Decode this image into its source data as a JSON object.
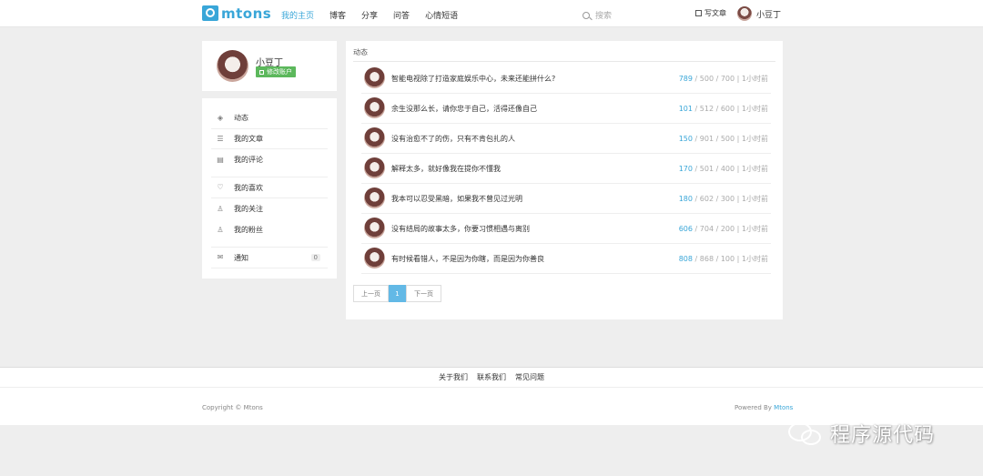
{
  "header": {
    "logo_text": "mtons",
    "nav": [
      "我的主页",
      "博客",
      "分享",
      "问答",
      "心情短语"
    ],
    "search_placeholder": "搜索",
    "write_label": "写文章",
    "username": "小豆丁"
  },
  "profile": {
    "name": "小豆丁",
    "edit_label": "修改账户"
  },
  "menu": {
    "items": [
      {
        "label": "动态",
        "icon": "layers-icon",
        "glyph": "◈"
      },
      {
        "label": "我的文章",
        "icon": "list-icon",
        "glyph": "☰"
      },
      {
        "label": "我的评论",
        "icon": "comment-icon",
        "glyph": "▤"
      },
      {
        "label": "我的喜欢",
        "icon": "heart-icon",
        "glyph": "♡"
      },
      {
        "label": "我的关注",
        "icon": "user-icon",
        "glyph": "♙"
      },
      {
        "label": "我的粉丝",
        "icon": "user-icon",
        "glyph": "♙"
      },
      {
        "label": "通知",
        "icon": "mail-icon",
        "glyph": "✉"
      }
    ],
    "notify_count": "0"
  },
  "feed": {
    "title": "动态",
    "rows": [
      {
        "text": "智能电视除了打造家庭娱乐中心，未来还能拼什么?",
        "a": "789",
        "b": "500",
        "c": "700",
        "time": "1小时前"
      },
      {
        "text": "余生没那么长，请你忠于自己，活得还像自己",
        "a": "101",
        "b": "512",
        "c": "600",
        "time": "1小时前"
      },
      {
        "text": "没有治愈不了的伤，只有不肯包扎的人",
        "a": "150",
        "b": "901",
        "c": "500",
        "time": "1小时前"
      },
      {
        "text": "解释太多，就好像我在提你不懂我",
        "a": "170",
        "b": "501",
        "c": "400",
        "time": "1小时前"
      },
      {
        "text": "我本可以忍受黑暗，如果我不曾见过光明",
        "a": "180",
        "b": "602",
        "c": "300",
        "time": "1小时前"
      },
      {
        "text": "没有结局的故事太多，你要习惯相遇与离别",
        "a": "606",
        "b": "704",
        "c": "200",
        "time": "1小时前"
      },
      {
        "text": "有时候看错人，不是因为你瞎，而是因为你善良",
        "a": "808",
        "b": "868",
        "c": "100",
        "time": "1小时前"
      }
    ]
  },
  "pager": {
    "prev": "上一页",
    "current": "1",
    "next": "下一页"
  },
  "footer": {
    "links": [
      "关于我们",
      "联系我们",
      "常见问题"
    ],
    "copyright": "Copyright © Mtons",
    "powered_prefix": "Powered By ",
    "powered_brand": "Mtons"
  },
  "watermark": {
    "text": "程序源代码"
  },
  "colors": {
    "accent": "#39a6d8",
    "green": "#5cb85c",
    "background": "#eeeeee"
  }
}
